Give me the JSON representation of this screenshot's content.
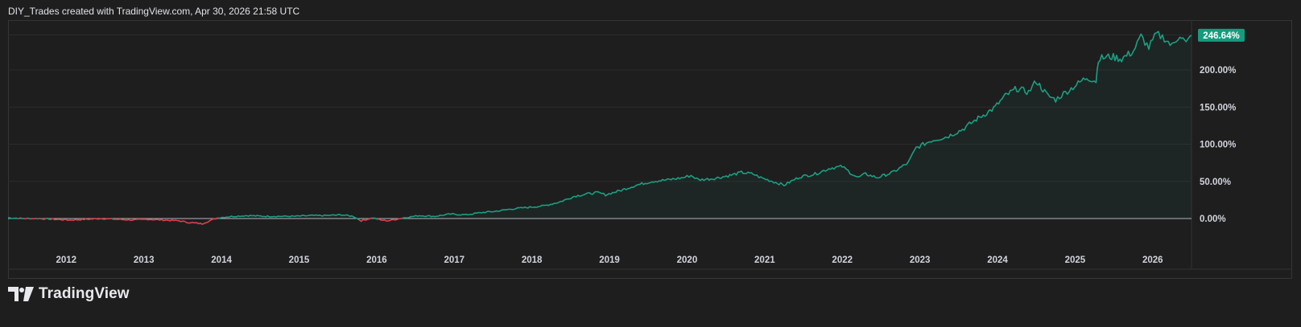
{
  "header": {
    "attribution": "DIY_Trades created with TradingView.com, Apr 30, 2026 21:58 UTC"
  },
  "brand": {
    "logo_text": "TradingView",
    "logo_icon": "tradingview-logo-icon"
  },
  "colors": {
    "background": "#1e1e1e",
    "grid": "#2b2b2b",
    "positive_line": "#1a9f82",
    "negative_line": "#e0404c",
    "zero_line": "#b2b5be",
    "badge": "#159b7e"
  },
  "chart_data": {
    "type": "line",
    "title": "",
    "xlabel": "",
    "ylabel": "",
    "y_unit": "%",
    "ylim": [
      -70,
      250
    ],
    "xlim": [
      2011.3,
      2026.55
    ],
    "grid": true,
    "y_ticks": [
      0,
      50,
      100,
      150,
      200
    ],
    "y_tick_labels": [
      "0.00%",
      "50.00%",
      "100.00%",
      "150.00%",
      "200.00%"
    ],
    "x_ticks": [
      2012,
      2013,
      2014,
      2015,
      2016,
      2017,
      2018,
      2019,
      2020,
      2021,
      2022,
      2023,
      2024,
      2025,
      2026
    ],
    "x_tick_labels": [
      "2012",
      "2013",
      "2014",
      "2015",
      "2016",
      "2017",
      "2018",
      "2019",
      "2020",
      "2021",
      "2022",
      "2023",
      "2024",
      "2025",
      "2026"
    ],
    "last_value_label": "246.64%",
    "series": [
      {
        "x": [
          2011.3,
          2011.5,
          2011.7,
          2011.9,
          2012.1,
          2012.3,
          2012.5,
          2012.7,
          2012.9,
          2013.1,
          2013.3,
          2013.5,
          2013.6,
          2013.8,
          2013.9,
          2014.0,
          2014.2,
          2014.4,
          2014.6,
          2014.8,
          2015.0,
          2015.2,
          2015.4,
          2015.6,
          2015.75,
          2015.85,
          2016.0,
          2016.1,
          2016.2,
          2016.4,
          2016.6,
          2016.8,
          2017.0,
          2017.2,
          2017.4,
          2017.6,
          2017.8,
          2018.0,
          2018.2,
          2018.4,
          2018.6,
          2018.75,
          2018.9,
          2019.0,
          2019.2,
          2019.4,
          2019.6,
          2019.8,
          2020.0,
          2020.1,
          2020.2,
          2020.4,
          2020.6,
          2020.75,
          2020.9,
          2021.0,
          2021.15,
          2021.3,
          2021.5,
          2021.7,
          2021.9,
          2022.05,
          2022.15,
          2022.25,
          2022.35,
          2022.5,
          2022.7,
          2022.9,
          2023.0,
          2023.2,
          2023.4,
          2023.6,
          2023.8,
          2024.0,
          2024.15,
          2024.3,
          2024.45,
          2024.55,
          2024.7,
          2024.8,
          2024.9,
          2025.0,
          2025.2,
          2025.32,
          2025.35,
          2025.5,
          2025.65,
          2025.8,
          2025.9,
          2026.0,
          2026.1,
          2026.2,
          2026.3,
          2026.4,
          2026.48,
          2026.55
        ],
        "values": [
          1,
          0,
          0,
          -1,
          -2,
          -1,
          0,
          -1,
          -2,
          -1,
          -2,
          -3,
          -5,
          -7,
          -3,
          1,
          3,
          4,
          3,
          3,
          3,
          4,
          4,
          5,
          3,
          -3,
          1,
          -2,
          -3,
          1,
          4,
          3,
          6,
          5,
          8,
          10,
          13,
          15,
          17,
          22,
          30,
          33,
          35,
          32,
          38,
          45,
          50,
          52,
          55,
          58,
          52,
          54,
          58,
          62,
          60,
          55,
          50,
          45,
          56,
          60,
          68,
          70,
          62,
          55,
          60,
          55,
          62,
          75,
          95,
          105,
          110,
          120,
          135,
          148,
          165,
          175,
          170,
          185,
          165,
          160,
          168,
          175,
          190,
          185,
          215,
          218,
          215,
          225,
          245,
          230,
          248,
          243,
          232,
          248,
          235,
          246.64
        ]
      }
    ]
  }
}
